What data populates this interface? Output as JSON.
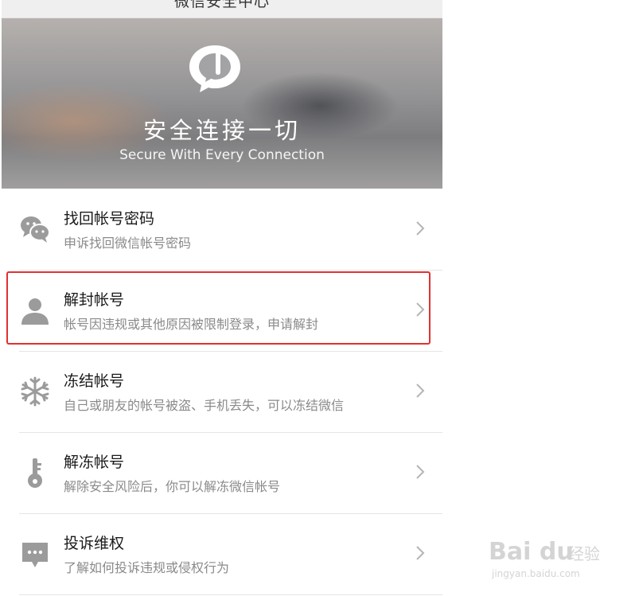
{
  "topbar": {
    "title": "微信安全中心"
  },
  "banner": {
    "title": "安全连接一切",
    "subtitle": "Secure With Every Connection",
    "logo_icon": "chat-bubble-icon"
  },
  "items": [
    {
      "icon": "wechat-icon",
      "title": "找回帐号密码",
      "desc": "申诉找回微信帐号密码"
    },
    {
      "icon": "person-icon",
      "title": "解封帐号",
      "desc": "帐号因违规或其他原因被限制登录，申请解封"
    },
    {
      "icon": "snowflake-icon",
      "title": "冻结帐号",
      "desc": "自己或朋友的帐号被盗、手机丢失，可以冻结微信"
    },
    {
      "icon": "key-icon",
      "title": "解冻帐号",
      "desc": "解除安全风险后，你可以解冻微信帐号"
    },
    {
      "icon": "complaint-icon",
      "title": "投诉维权",
      "desc": "了解如何投诉违规或侵权行为"
    }
  ],
  "highlight_color": "#e03131",
  "watermark": {
    "logo": "Bai du",
    "brand": "经验",
    "url": "jingyan.baidu.com"
  }
}
